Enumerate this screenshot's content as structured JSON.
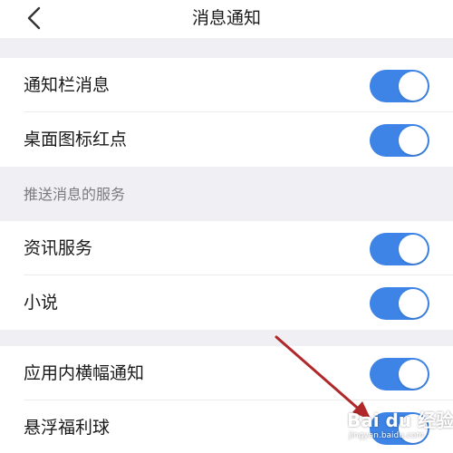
{
  "header": {
    "title": "消息通知",
    "back_icon": "chevron-left-icon"
  },
  "settings": [
    {
      "id": "notification-bar-messages",
      "label": "通知栏消息",
      "enabled": true
    },
    {
      "id": "desktop-icon-badge",
      "label": "桌面图标红点",
      "enabled": true
    }
  ],
  "push_section": {
    "header": "推送消息的服务",
    "items": [
      {
        "id": "news-service",
        "label": "资讯服务",
        "enabled": true
      },
      {
        "id": "novels",
        "label": "小说",
        "enabled": true
      }
    ]
  },
  "more_settings": [
    {
      "id": "in-app-banner",
      "label": "应用内横幅通知",
      "enabled": true
    },
    {
      "id": "floating-bonus-ball",
      "label": "悬浮福利球",
      "enabled": true
    }
  ],
  "watermark": {
    "logo": "Bai du 经验",
    "url": "jingyan.baidu.com"
  },
  "colors": {
    "toggle_on": "#3d84e6",
    "section_bg": "#efeff4",
    "annotation_arrow": "#b0282a"
  }
}
